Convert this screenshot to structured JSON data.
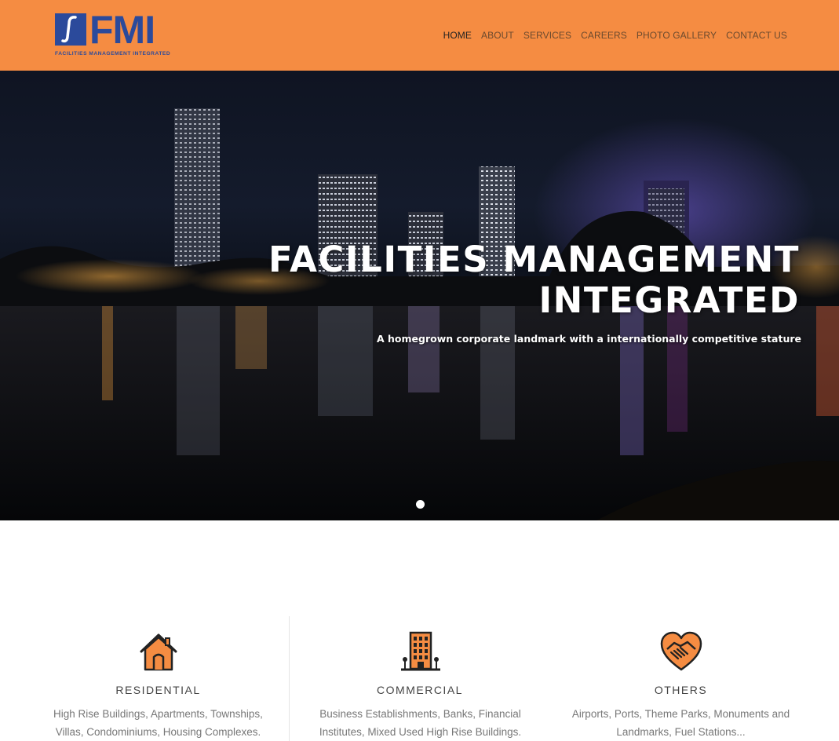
{
  "brand": {
    "logo_text": "FMI",
    "logo_tagline": "FACILITIES MANAGEMENT INTEGRATED",
    "primary_color": "#2b4a9b",
    "header_color": "#f58c42"
  },
  "nav": {
    "items": [
      {
        "label": "HOME",
        "active": true
      },
      {
        "label": "ABOUT",
        "active": false
      },
      {
        "label": "SERVICES",
        "active": false
      },
      {
        "label": "CAREERS",
        "active": false
      },
      {
        "label": "PHOTO GALLERY",
        "active": false
      },
      {
        "label": "CONTACT US",
        "active": false
      }
    ]
  },
  "hero": {
    "title_line1": "FACILITIES MANAGEMENT",
    "title_line2": "INTEGRATED",
    "subtitle": "A homegrown corporate landmark with a internationally competitive stature",
    "slides": 1,
    "active_slide": 1
  },
  "services": [
    {
      "icon": "house-icon",
      "title": "RESIDENTIAL",
      "description": "High Rise Buildings, Apartments, Townships, Villas, Condominiums, Housing Complexes."
    },
    {
      "icon": "building-icon",
      "title": "COMMERCIAL",
      "description": "Business Establishments, Banks, Financial Institutes, Mixed Used High Rise Buildings."
    },
    {
      "icon": "handshake-heart-icon",
      "title": "OTHERS",
      "description": "Airports, Ports, Theme Parks, Monuments and Landmarks, Fuel Stations..."
    }
  ]
}
